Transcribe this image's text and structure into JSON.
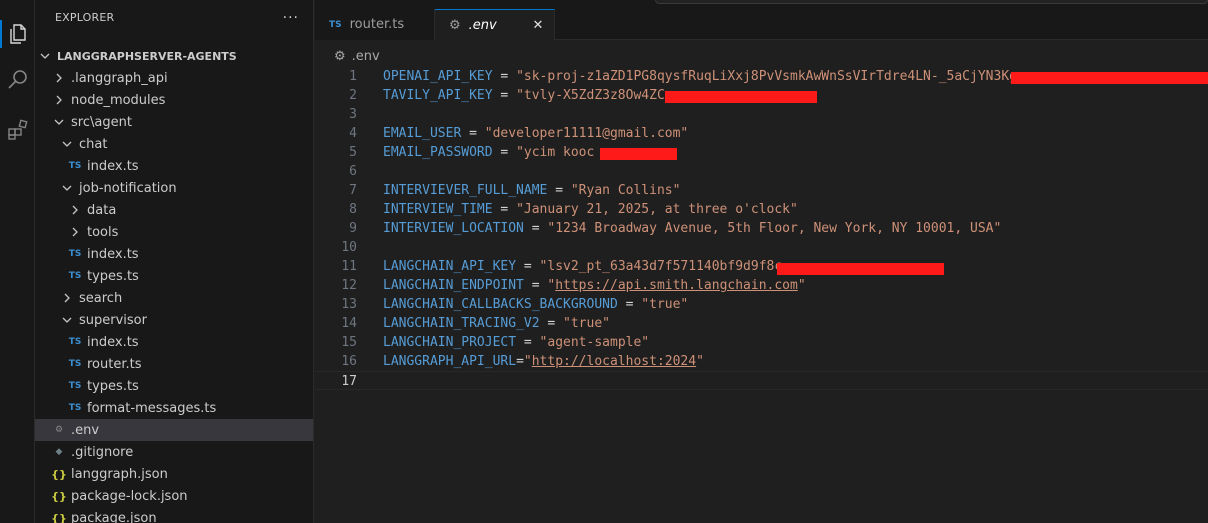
{
  "explorer": {
    "title": "EXPLORER",
    "more": "···",
    "tree": [
      {
        "label": "LANGGRAPHSERVER-AGENTS",
        "type": "root",
        "level": 0,
        "expanded": true
      },
      {
        "label": ".langgraph_api",
        "type": "folder",
        "level": 1,
        "expanded": false
      },
      {
        "label": "node_modules",
        "type": "folder",
        "level": 1,
        "expanded": false
      },
      {
        "label": "src\\agent",
        "type": "folder",
        "level": 1,
        "expanded": true
      },
      {
        "label": "chat",
        "type": "folder",
        "level": 2,
        "expanded": true
      },
      {
        "label": "index.ts",
        "type": "ts",
        "level": 3
      },
      {
        "label": "job-notification",
        "type": "folder",
        "level": 2,
        "expanded": true
      },
      {
        "label": "data",
        "type": "folder",
        "level": 3,
        "expanded": false
      },
      {
        "label": "tools",
        "type": "folder",
        "level": 3,
        "expanded": false
      },
      {
        "label": "index.ts",
        "type": "ts",
        "level": 3
      },
      {
        "label": "types.ts",
        "type": "ts",
        "level": 3
      },
      {
        "label": "search",
        "type": "folder",
        "level": 2,
        "expanded": false
      },
      {
        "label": "supervisor",
        "type": "folder",
        "level": 2,
        "expanded": true
      },
      {
        "label": "index.ts",
        "type": "ts",
        "level": 3
      },
      {
        "label": "router.ts",
        "type": "ts",
        "level": 3
      },
      {
        "label": "types.ts",
        "type": "ts",
        "level": 3
      },
      {
        "label": "format-messages.ts",
        "type": "ts",
        "level": 2
      },
      {
        "label": ".env",
        "type": "gear",
        "level": 1,
        "selected": true
      },
      {
        "label": ".gitignore",
        "type": "git",
        "level": 1
      },
      {
        "label": "langgraph.json",
        "type": "json",
        "level": 1
      },
      {
        "label": "package-lock.json",
        "type": "json",
        "level": 1
      },
      {
        "label": "package.json",
        "type": "json",
        "level": 1
      }
    ]
  },
  "tabs": [
    {
      "label": "router.ts",
      "icon": "ts",
      "active": false
    },
    {
      "label": ".env",
      "icon": "gear",
      "active": true,
      "close": "✕"
    }
  ],
  "breadcrumb": ".env",
  "icon_badges": {
    "ts": "TS",
    "json": "{}"
  },
  "editor": {
    "current_line": 17,
    "lines": [
      {
        "n": "1",
        "tokens": [
          [
            "k",
            "OPENAI_API_KEY"
          ],
          [
            "o",
            " = "
          ],
          [
            "s",
            "\"sk-proj-z1aZD1PG8qysfRuqLiXxj8PvVsmkAwWnSsVIrTdre4LN-_5aCjYN3Kg"
          ]
        ]
      },
      {
        "n": "2",
        "tokens": [
          [
            "k",
            "TAVILY_API_KEY"
          ],
          [
            "o",
            " = "
          ],
          [
            "s",
            "\"tvly-X5ZdZ3z8Ow4ZC"
          ]
        ]
      },
      {
        "n": "3",
        "tokens": []
      },
      {
        "n": "4",
        "tokens": [
          [
            "k",
            "EMAIL_USER"
          ],
          [
            "o",
            " = "
          ],
          [
            "s",
            "\"developer11111@gmail.com\""
          ]
        ]
      },
      {
        "n": "5",
        "tokens": [
          [
            "k",
            "EMAIL_PASSWORD"
          ],
          [
            "o",
            " = "
          ],
          [
            "s",
            "\"ycim kooc"
          ]
        ]
      },
      {
        "n": "6",
        "tokens": []
      },
      {
        "n": "7",
        "tokens": [
          [
            "k",
            "INTERVIEVER_FULL_NAME"
          ],
          [
            "o",
            " = "
          ],
          [
            "s",
            "\"Ryan Collins\""
          ]
        ]
      },
      {
        "n": "8",
        "tokens": [
          [
            "k",
            "INTERVIEW_TIME"
          ],
          [
            "o",
            " = "
          ],
          [
            "s",
            "\"January 21, 2025, at three o'clock\""
          ]
        ]
      },
      {
        "n": "9",
        "tokens": [
          [
            "k",
            "INTERVIEW_LOCATION"
          ],
          [
            "o",
            " = "
          ],
          [
            "s",
            "\"1234 Broadway Avenue, 5th Floor, New York, NY 10001, USA\""
          ]
        ]
      },
      {
        "n": "10",
        "tokens": []
      },
      {
        "n": "11",
        "tokens": [
          [
            "k",
            "LANGCHAIN_API_KEY"
          ],
          [
            "o",
            " = "
          ],
          [
            "s",
            "\"lsv2_pt_63a43d7f571140bf9d9f8c"
          ]
        ]
      },
      {
        "n": "12",
        "tokens": [
          [
            "k",
            "LANGCHAIN_ENDPOINT"
          ],
          [
            "o",
            " = "
          ],
          [
            "s",
            "\""
          ],
          [
            "su",
            "https://api.smith.langchain.com"
          ],
          [
            "s",
            "\""
          ]
        ]
      },
      {
        "n": "13",
        "tokens": [
          [
            "k",
            "LANGCHAIN_CALLBACKS_BACKGROUND"
          ],
          [
            "o",
            " = "
          ],
          [
            "s",
            "\"true\""
          ]
        ]
      },
      {
        "n": "14",
        "tokens": [
          [
            "k",
            "LANGCHAIN_TRACING_V2"
          ],
          [
            "o",
            " = "
          ],
          [
            "s",
            "\"true\""
          ]
        ]
      },
      {
        "n": "15",
        "tokens": [
          [
            "k",
            "LANGCHAIN_PROJECT"
          ],
          [
            "o",
            " = "
          ],
          [
            "s",
            "\"agent-sample\""
          ]
        ]
      },
      {
        "n": "16",
        "tokens": [
          [
            "k",
            "LANGGRAPH_API_URL"
          ],
          [
            "o",
            "="
          ],
          [
            "s",
            "\""
          ],
          [
            "su",
            "http://localhost:2024"
          ],
          [
            "s",
            "\""
          ]
        ]
      },
      {
        "n": "17",
        "tokens": []
      }
    ]
  },
  "colors": {
    "accent": "#0078d4",
    "redaction": "#ff1a1a",
    "key": "#569cd6",
    "string": "#ce9178"
  }
}
